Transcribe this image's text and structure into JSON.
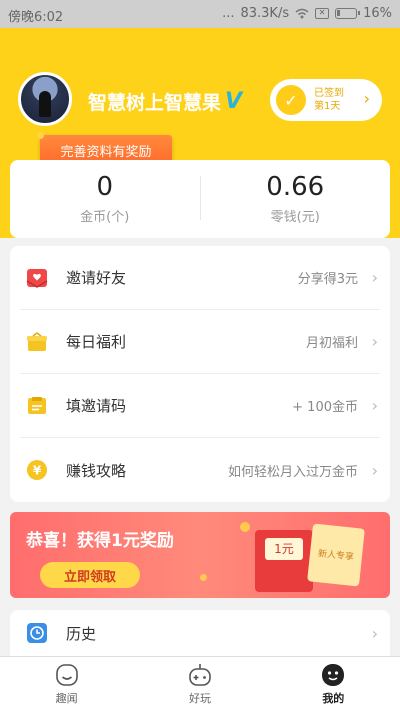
{
  "status_bar": {
    "time": "傍晚6:02",
    "dots": "...",
    "speed": "83.3K/s",
    "battery": "16%",
    "battery_level": 0.16
  },
  "profile": {
    "username": "智慧树上智慧果",
    "vip_mark": "V",
    "reward_badge": "完善资料有奖励"
  },
  "signin": {
    "line1": "已签到",
    "line2": "第1天"
  },
  "stats": [
    {
      "value": "0",
      "label": "金币(个)"
    },
    {
      "value": "0.66",
      "label": "零钱(元)"
    }
  ],
  "menu": [
    {
      "label": "邀请好友",
      "value": "分享得3元",
      "icon": "invite-envelope-icon"
    },
    {
      "label": "每日福利",
      "value": "月初福利",
      "icon": "gift-box-icon"
    },
    {
      "label": "填邀请码",
      "value": "+ 100金币",
      "icon": "invite-code-icon"
    },
    {
      "label": "赚钱攻略",
      "value": "如何轻松月入过万金币",
      "icon": "yen-coin-icon"
    }
  ],
  "banner": {
    "title": "恭喜！获得1元奖励",
    "button": "立即领取",
    "coupon": "1元",
    "card_text": "新人专享"
  },
  "history": {
    "label": "历史",
    "icon": "clock-icon"
  },
  "tabs": [
    {
      "label": "趣闻",
      "icon": "smile-face-icon",
      "active": false
    },
    {
      "label": "好玩",
      "icon": "gamepad-icon",
      "active": false
    },
    {
      "label": "我的",
      "icon": "profile-face-icon",
      "active": true
    }
  ],
  "colors": {
    "header": "#ffd21a",
    "accent_orange": "#ff6a2a",
    "banner_red": "#ff6d6d"
  }
}
